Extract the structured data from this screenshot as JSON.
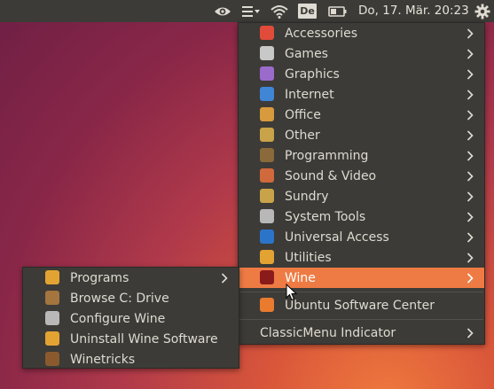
{
  "top_bar": {
    "icons": [
      "eye-icon",
      "menu-icon",
      "wifi-icon",
      "keyboard-layout-icon",
      "battery-icon",
      "gear-icon"
    ],
    "keyboard_layout": "De",
    "clock": "Do, 17. Mär. 20:23"
  },
  "main_menu": {
    "items": [
      {
        "label": "Accessories",
        "icon": "accessories-icon",
        "has_submenu": true
      },
      {
        "label": "Games",
        "icon": "games-icon",
        "has_submenu": true
      },
      {
        "label": "Graphics",
        "icon": "graphics-icon",
        "has_submenu": true
      },
      {
        "label": "Internet",
        "icon": "internet-icon",
        "has_submenu": true
      },
      {
        "label": "Office",
        "icon": "office-icon",
        "has_submenu": true
      },
      {
        "label": "Other",
        "icon": "other-icon",
        "has_submenu": true
      },
      {
        "label": "Programming",
        "icon": "programming-icon",
        "has_submenu": true
      },
      {
        "label": "Sound & Video",
        "icon": "sound-video-icon",
        "has_submenu": true
      },
      {
        "label": "Sundry",
        "icon": "sundry-icon",
        "has_submenu": true
      },
      {
        "label": "System Tools",
        "icon": "system-tools-icon",
        "has_submenu": true
      },
      {
        "label": "Universal Access",
        "icon": "universal-access-icon",
        "has_submenu": true
      },
      {
        "label": "Utilities",
        "icon": "utilities-icon",
        "has_submenu": true
      },
      {
        "label": "Wine",
        "icon": "wine-icon",
        "has_submenu": true,
        "highlighted": true
      }
    ],
    "software_center": {
      "label": "Ubuntu Software Center",
      "icon": "software-center-icon"
    },
    "classic_menu": {
      "label": "ClassicMenu Indicator",
      "has_submenu": true
    }
  },
  "wine_submenu": {
    "items": [
      {
        "label": "Programs",
        "icon": "folder-icon",
        "has_submenu": true
      },
      {
        "label": "Browse C: Drive",
        "icon": "browse-drive-icon"
      },
      {
        "label": "Configure Wine",
        "icon": "configure-icon"
      },
      {
        "label": "Uninstall Wine Software",
        "icon": "uninstall-icon"
      },
      {
        "label": "Winetricks",
        "icon": "winetricks-icon"
      }
    ]
  },
  "colors": {
    "panel": "#3c3b37",
    "menu_text": "#dfdbd2",
    "highlight": "#ef7b44"
  }
}
